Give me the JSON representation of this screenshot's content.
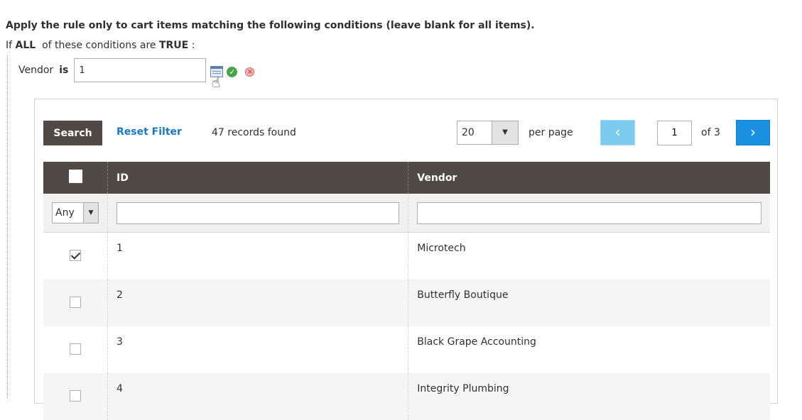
{
  "rule": {
    "heading": "Apply the rule only to cart items matching the following conditions (leave blank for all items).",
    "if_prefix": "If",
    "aggregator": "ALL",
    "middle": "of these conditions are",
    "value": "TRUE",
    "suffix": ":"
  },
  "condition": {
    "attribute": "Vendor",
    "operator": "is",
    "value": "1",
    "icons": [
      "chooser-icon",
      "apply-check-icon",
      "remove-icon"
    ]
  },
  "grid_toolbar": {
    "search_label": "Search",
    "reset_label": "Reset Filter",
    "records_text": "47 records found",
    "per_page_value": "20",
    "per_page_label": "per page",
    "page_current": "1",
    "page_of": "of 3",
    "prev_icon": "chevron-left-icon",
    "next_icon": "chevron-right-icon"
  },
  "grid": {
    "columns": [
      "ID",
      "Vendor"
    ],
    "filter_any": "Any",
    "rows": [
      {
        "checked": true,
        "id": "1",
        "vendor": "Microtech"
      },
      {
        "checked": false,
        "id": "2",
        "vendor": "Butterfly Boutique"
      },
      {
        "checked": false,
        "id": "3",
        "vendor": "Black Grape Accounting"
      },
      {
        "checked": false,
        "id": "4",
        "vendor": "Integrity Plumbing"
      }
    ]
  },
  "colors": {
    "header_bg": "#514943",
    "link": "#1979c3",
    "next_button": "#1a90e0",
    "prev_button_disabled": "#7ecbf0"
  }
}
